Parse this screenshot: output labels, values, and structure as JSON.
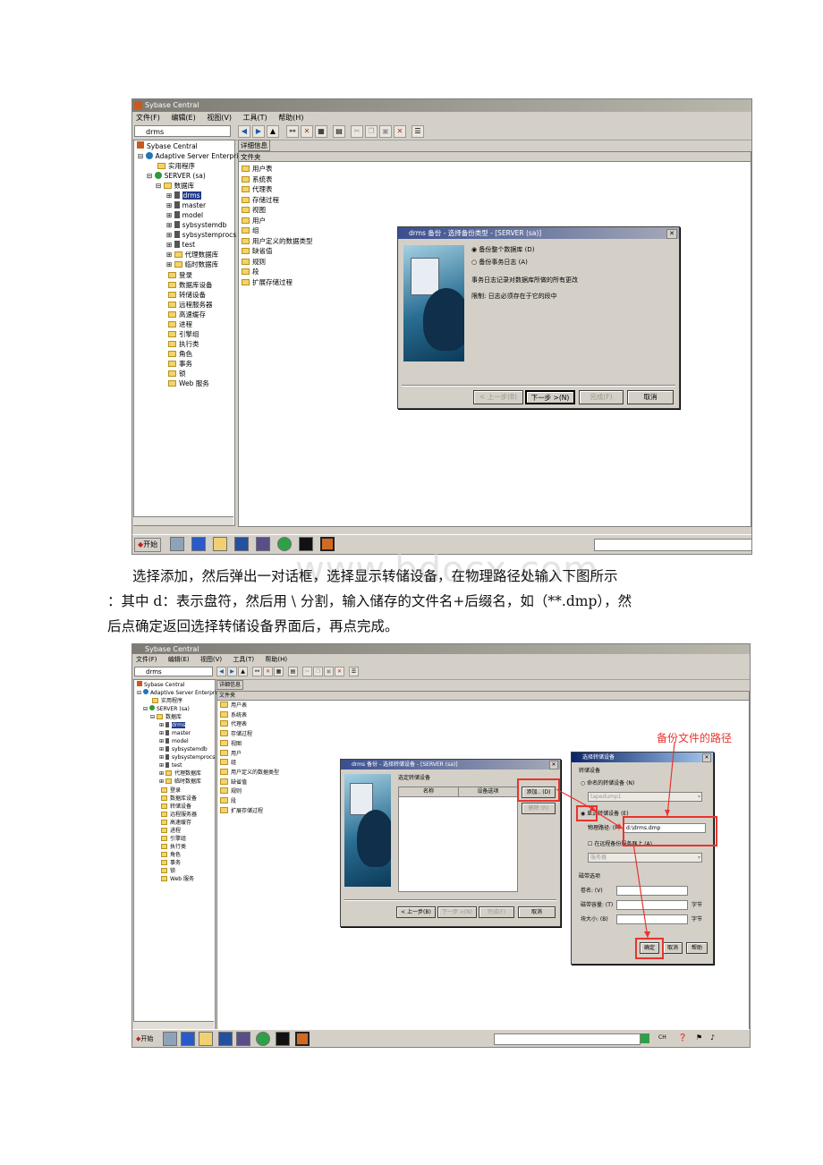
{
  "shot1": {
    "window_title": "Sybase Central",
    "menus": [
      "文件(F)",
      "编辑(E)",
      "视图(V)",
      "工具(T)",
      "帮助(H)"
    ],
    "db_combo": "drms",
    "tree": {
      "root": "Sybase Central",
      "ase": "Adaptive Server Enterprise",
      "utility": "实用程序",
      "server": "SERVER (sa)",
      "databases_folder": "数据库",
      "databases": [
        "drms",
        "master",
        "model",
        "sybsystemdb",
        "sybsystemprocs",
        "test"
      ],
      "db_subfolders": [
        "代理数据库",
        "临时数据库"
      ],
      "folders": [
        "登录",
        "数据库设备",
        "转储设备",
        "远程服务器",
        "高速缓存",
        "进程",
        "引擎组",
        "执行类",
        "角色",
        "事务",
        "锁",
        "Web 服务"
      ]
    },
    "detail_tab": "详细信息",
    "column_header": "文件夹",
    "folder_list": [
      "用户表",
      "系统表",
      "代理表",
      "存储过程",
      "视图",
      "用户",
      "组",
      "用户定义的数据类型",
      "缺省值",
      "规则",
      "段",
      "扩展存储过程"
    ],
    "dialog": {
      "title": "drms 备份 - 选择备份类型 - [SERVER (sa)]",
      "option1": "备份整个数据库 (D)",
      "option2": "备份事务日志 (A)",
      "desc": "事务日志记录对数据库所做的所有更改",
      "limit": "限制: 日志必须存在于它的段中",
      "buttons": {
        "back": "< 上一步(B)",
        "next": "下一步 >(N)",
        "finish": "完成(F)",
        "cancel": "取消"
      }
    },
    "taskbar_start": "开始"
  },
  "paragraph": {
    "line1": "选择添加，然后弹出一对话框，选择显示转储设备，在物理路径处输入下图所示",
    "line2": "：其中 d：表示盘符，然后用 \\ 分割，输入储存的文件名+后缀名，如（**.dmp），然",
    "line3": "后点确定返回选择转储设备界面后，再点完成。"
  },
  "watermark": "www.bdocx.com",
  "shot2": {
    "window_title": "Sybase Central",
    "menus": [
      "文件(F)",
      "编辑(E)",
      "视图(V)",
      "工具(T)",
      "帮助(H)"
    ],
    "db_combo": "drms",
    "detail_tab": "详细信息",
    "column_header": "文件夹",
    "dialog_a": {
      "title": "drms 备份 - 选择转储设备 - [SERVER (sa)]",
      "section": "选定转储设备",
      "col_name": "名称",
      "col_options": "设备选项",
      "add_button": "添加.. (D)",
      "remove_button": "删除 (R)",
      "buttons": {
        "back": "< 上一步(B)",
        "next": "下一步 >(N)",
        "finish": "完成(F)",
        "cancel": "取消"
      }
    },
    "dialog_b": {
      "title": "选择转储设备",
      "group_label": "转储设备",
      "opt_named": "命名的转储设备 (N)",
      "named_value": "tapedump1",
      "opt_explicit": "显式转储设备 (E)",
      "path_label": "物理路径: (P)",
      "path_value": "d:\\drms.dmp",
      "remote_check": "在远程备份服务器上 (A)",
      "remote_value": "服务器",
      "options_label": "磁带选项",
      "vol_label": "卷名: (V)",
      "cap_label": "磁带容量: (T)",
      "cap_unit": "字节",
      "block_label": "块大小: (B)",
      "block_unit": "字节",
      "ok": "确定",
      "cancel": "取消",
      "help": "帮助"
    },
    "annotation": "备份文件的路径",
    "taskbar_start": "开始",
    "tray_lang": "CH"
  },
  "colors": {
    "annotation_red": "#e8342e",
    "title_blue": "#3a4f8f",
    "window_gray": "#d4d0c8"
  }
}
